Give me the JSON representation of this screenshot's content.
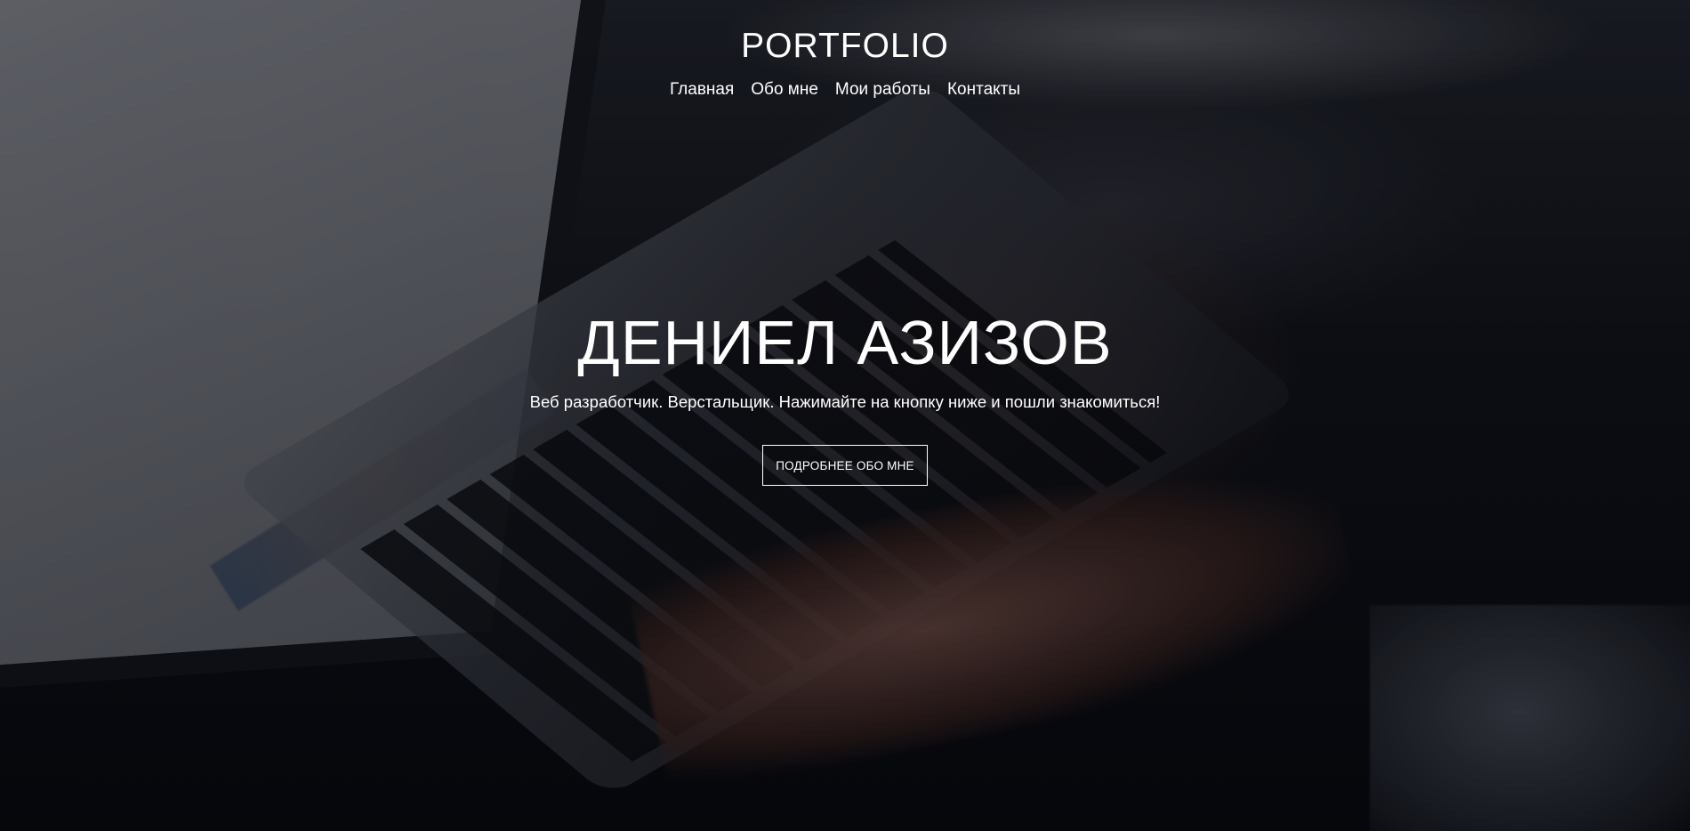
{
  "header": {
    "logo": "PORTFOLIO",
    "nav": [
      {
        "label": "Главная"
      },
      {
        "label": "Обо мне"
      },
      {
        "label": "Мои работы"
      },
      {
        "label": "Контакты"
      }
    ]
  },
  "hero": {
    "name": "ДЕНИЕЛ АЗИЗОВ",
    "tagline": "Веб разработчик. Верстальщик. Нажимайте на кнопку ниже и пошли знакомиться!",
    "cta_label": "ПОДРОБНЕЕ ОБО МНЕ",
    "background_image": "laptop-typing-photo",
    "overlay_color": "#05060c"
  }
}
